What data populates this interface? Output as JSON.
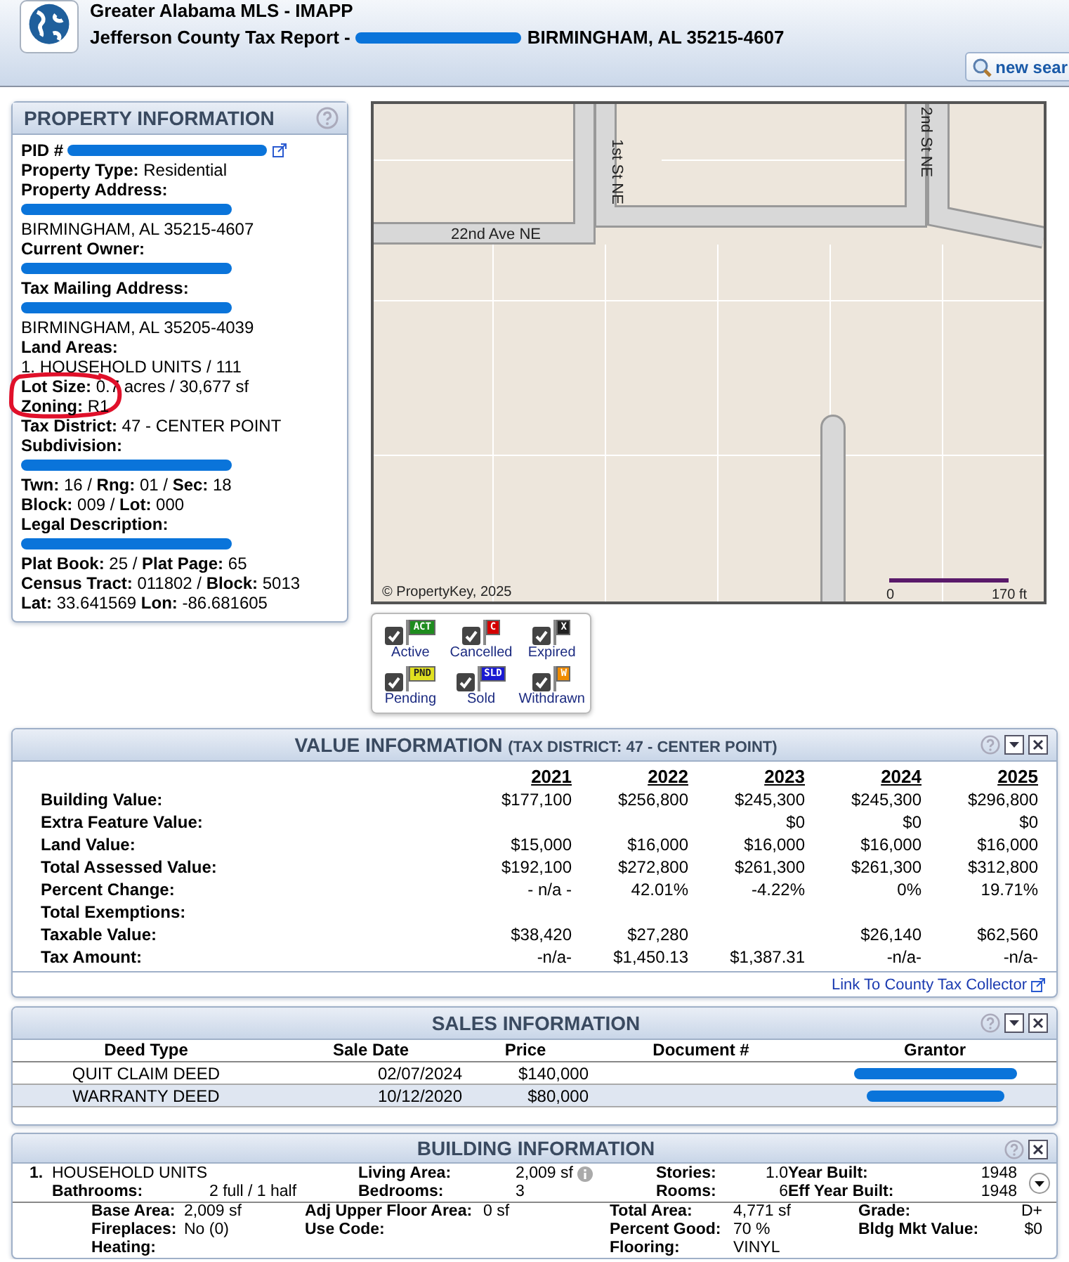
{
  "header": {
    "app_title": "Greater Alabama MLS - IMAPP",
    "report_prefix": "Jefferson County Tax Report -",
    "report_suffix": "BIRMINGHAM, AL 35215-4607",
    "search_button": "new sear"
  },
  "property": {
    "title": "PROPERTY INFORMATION",
    "fields": [
      {
        "kind": "pid",
        "text": "PID #"
      },
      {
        "kind": "line",
        "text": "**Property Type:**  Residential"
      },
      {
        "kind": "heading",
        "text": "Property Address:"
      },
      {
        "kind": "redacted"
      },
      {
        "kind": "line",
        "text": "BIRMINGHAM, AL 35215-4607"
      },
      {
        "kind": "heading",
        "text": "Current Owner:"
      },
      {
        "kind": "redacted"
      },
      {
        "kind": "heading",
        "text": "Tax Mailing Address:"
      },
      {
        "kind": "redacted"
      },
      {
        "kind": "line",
        "text": "BIRMINGHAM, AL 35205-4039"
      },
      {
        "kind": "heading",
        "text": "Land Areas:"
      },
      {
        "kind": "line",
        "text": "1. HOUSEHOLD UNITS / 111"
      },
      {
        "kind": "line",
        "text": "**Lot Size:** 0.7 acres / 30,677 sf",
        "circled": true
      },
      {
        "kind": "line",
        "text": "**Zoning:** R1"
      },
      {
        "kind": "line",
        "text": "**Tax District:** 47 - CENTER POINT"
      },
      {
        "kind": "heading",
        "text": "Subdivision:"
      },
      {
        "kind": "redacted"
      },
      {
        "kind": "line",
        "text": "**Twn:** 16 / **Rng:** 01 / **Sec:** 18"
      },
      {
        "kind": "line",
        "text": "**Block:** 009 / **Lot:** 000"
      },
      {
        "kind": "heading",
        "text": "Legal Description:"
      },
      {
        "kind": "redacted"
      },
      {
        "kind": "line",
        "text": "**Plat Book:** 25 / **Plat Page:** 65"
      },
      {
        "kind": "line",
        "text": "**Census Tract:** 011802 / **Block:** 5013"
      },
      {
        "kind": "line",
        "text": "**Lat:** 33.641569 **Lon:** -86.681605"
      }
    ]
  },
  "map": {
    "streets": [
      "22nd Ave NE",
      "1st St NE",
      "2nd St NE"
    ],
    "copyright": "© PropertyKey, 2025",
    "scale_start": "0",
    "scale_end": "170 ft"
  },
  "legend": [
    {
      "label": "Active",
      "code": "ACT",
      "color": "#1e8c1e",
      "checked": true
    },
    {
      "label": "Cancelled",
      "code": "C",
      "color": "#d40000",
      "checked": true
    },
    {
      "label": "Expired",
      "code": "X",
      "color": "#222222",
      "checked": true
    },
    {
      "label": "Pending",
      "code": "PND",
      "color": "#e0e020",
      "checked": true
    },
    {
      "label": "Sold",
      "code": "SLD",
      "color": "#1a1ad2",
      "checked": true
    },
    {
      "label": "Withdrawn",
      "code": "W",
      "color": "#f08c00",
      "checked": true
    }
  ],
  "value_info": {
    "title": "VALUE INFORMATION",
    "subtitle": "(TAX DISTRICT: 47 - CENTER POINT)",
    "collapsible": true,
    "years": [
      "2021",
      "2022",
      "2023",
      "2024",
      "2025"
    ],
    "rows": [
      {
        "label": "Building Value:",
        "values": {
          "col_1": "$177,100",
          "col_2": "$256,800",
          "col_3": "$245,300",
          "col_4": "$245,300",
          "col_5": "$296,800"
        }
      },
      {
        "label": "Extra Feature Value:",
        "values": {
          "col_3": "$0",
          "col_4": "$0",
          "col_5": "$0"
        }
      },
      {
        "label": "Land Value:",
        "values": {
          "col_1": "$15,000",
          "col_2": "$16,000",
          "col_3": "$16,000",
          "col_4": "$16,000",
          "col_5": "$16,000"
        }
      },
      {
        "label": "Total Assessed Value:",
        "values": {
          "col_1": "$192,100",
          "col_2": "$272,800",
          "col_3": "$261,300",
          "col_4": "$261,300",
          "col_5": "$312,800"
        }
      },
      {
        "label": "Percent Change:",
        "values": {
          "col_1": "- n/a -",
          "col_2": "42.01%",
          "col_3": "-4.22%",
          "col_4": "0%",
          "col_5": "19.71%"
        }
      },
      {
        "label": "Total Exemptions:"
      },
      {
        "label": "Taxable Value:",
        "values": {
          "col_1": "$38,420",
          "col_2": "$27,280",
          "col_4": "$26,140",
          "col_5": "$62,560"
        }
      },
      {
        "label": "Tax Amount:",
        "values": {
          "col_1": "-n/a-",
          "col_2": "$1,450.13",
          "col_3": "$1,387.31",
          "col_4": "-n/a-",
          "col_5": "-n/a-"
        }
      }
    ],
    "link": "Link To County Tax Collector"
  },
  "sales_info": {
    "title": "SALES INFORMATION",
    "collapsible": true,
    "columns": [
      "Deed Type",
      "Sale Date",
      "Price",
      "Document #",
      "Grantor"
    ],
    "rows": [
      {
        "deed_type": "QUIT CLAIM DEED",
        "sale_date": "02/07/2024",
        "price": "$140,000"
      },
      {
        "deed_type": "WARRANTY DEED",
        "sale_date": "10/12/2020",
        "price": "$80,000"
      }
    ]
  },
  "building_info": {
    "title": "BUILDING INFORMATION",
    "unit_number": "1.",
    "unit_name": "HOUSEHOLD UNITS",
    "summary": [
      [
        {
          "label": "Living Area:",
          "value": "2,009 sf",
          "info": true
        },
        {
          "label": "Stories:",
          "value": "1.0"
        },
        {
          "label": "Year Built:",
          "value": "1948"
        }
      ],
      [
        {
          "label": "Bathrooms:",
          "value": "2 full / 1 half"
        },
        {
          "label": "Bedrooms:",
          "value": "3"
        },
        {
          "label": "Rooms:",
          "value": "6"
        },
        {
          "label": "Eff Year Built:",
          "value": "1948"
        }
      ]
    ],
    "details": [
      {
        "col_1": {
          "label": "Base Area:",
          "value": "2,009 sf"
        },
        "col_2": {
          "label": "Adj Upper Floor Area:",
          "value": "0 sf"
        },
        "col_3": {
          "label": "Total Area:",
          "value": "4,771 sf"
        },
        "col_4": {
          "label": "Grade:",
          "value": "D+"
        }
      },
      {
        "col_1": {
          "label": "Fireplaces:",
          "value": "No (0)"
        },
        "col_2": {
          "label": "Use Code:"
        },
        "col_3": {
          "label": "Percent Good:",
          "value": "70 %"
        },
        "col_4": {
          "label": "Bldg Mkt Value:",
          "value": "$0"
        }
      },
      {
        "col_1": {
          "label": "Heating:"
        },
        "col_3": {
          "label": "Flooring:",
          "value": "VINYL"
        }
      }
    ]
  }
}
